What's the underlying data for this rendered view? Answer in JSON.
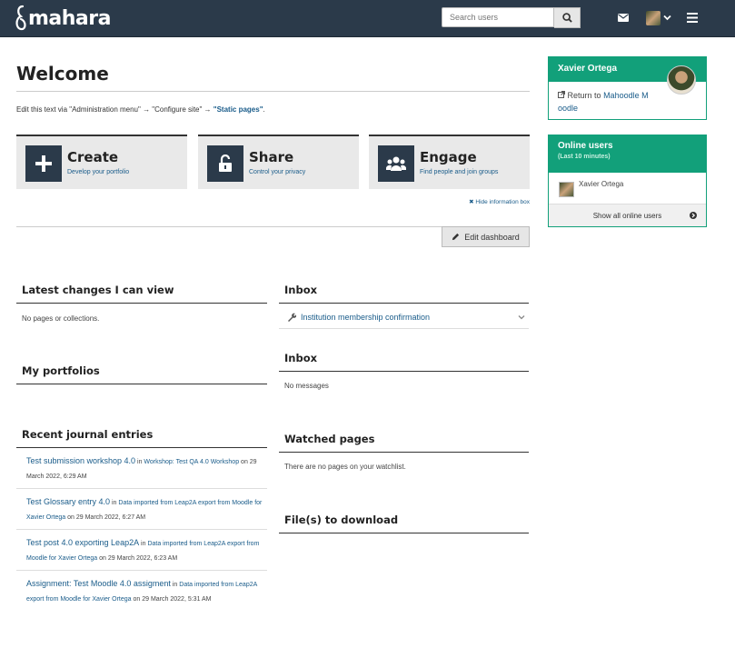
{
  "header": {
    "logo_text": "mahara",
    "search_placeholder": "Search users"
  },
  "welcome": {
    "title": "Welcome",
    "text_prefix": "Edit this text via \"Administration menu\" → \"Configure site\" → ",
    "text_link": "\"Static pages\"",
    "text_suffix": "."
  },
  "tiles": [
    {
      "title": "Create",
      "subtitle": "Develop your portfolio"
    },
    {
      "title": "Share",
      "subtitle": "Control your privacy"
    },
    {
      "title": "Engage",
      "subtitle": "Find people and join groups"
    }
  ],
  "hide_info_label": "✖ Hide information box",
  "edit_dashboard_label": "Edit dashboard",
  "blocks": {
    "latest_changes": {
      "title": "Latest changes I can view",
      "text": "No pages or collections."
    },
    "my_portfolios": {
      "title": "My portfolios"
    },
    "recent_journal": {
      "title": "Recent journal entries",
      "entries": [
        {
          "title": "Test submission workshop 4.0",
          "in": "in",
          "group": "Workshop: Test QA 4.0 Workshop",
          "date": "on 29 March 2022, 6:29 AM"
        },
        {
          "title": "Test Glossary entry 4.0",
          "in": "in",
          "group": "Data imported from Leap2A export from Moodle for Xavier Ortega",
          "date": "on 29 March 2022, 6:27 AM"
        },
        {
          "title": "Test post 4.0 exporting Leap2A",
          "in": "in",
          "group": "Data imported from Leap2A export from Moodle for Xavier Ortega",
          "date": "on 29 March 2022, 6:23 AM"
        },
        {
          "title": "Assignment: Test Moodle 4.0 assigment",
          "in": "in",
          "group": "Data imported from Leap2A export from Moodle for Xavier Ortega",
          "date": "on 29 March 2022, 5:31 AM"
        }
      ]
    },
    "inbox1": {
      "title": "Inbox",
      "item": "Institution membership confirmation"
    },
    "inbox2": {
      "title": "Inbox",
      "text": "No messages"
    },
    "watched": {
      "title": "Watched pages",
      "text": "There are no pages on your watchlist."
    },
    "downloads": {
      "title": "File(s) to download"
    }
  },
  "sidebar": {
    "profile": {
      "name": "Xavier Ortega",
      "return_prefix": "Return to",
      "return_line1": "Mahoodle M",
      "return_line2": "oodle"
    },
    "online": {
      "title": "Online users",
      "subtitle": "(Last 10 minutes)",
      "user": "Xavier Ortega",
      "show_all": "Show all online users"
    }
  },
  "colors": {
    "header_bg": "#2b3a4a",
    "accent_green": "#12a07a",
    "link": "#1a5c8a"
  }
}
